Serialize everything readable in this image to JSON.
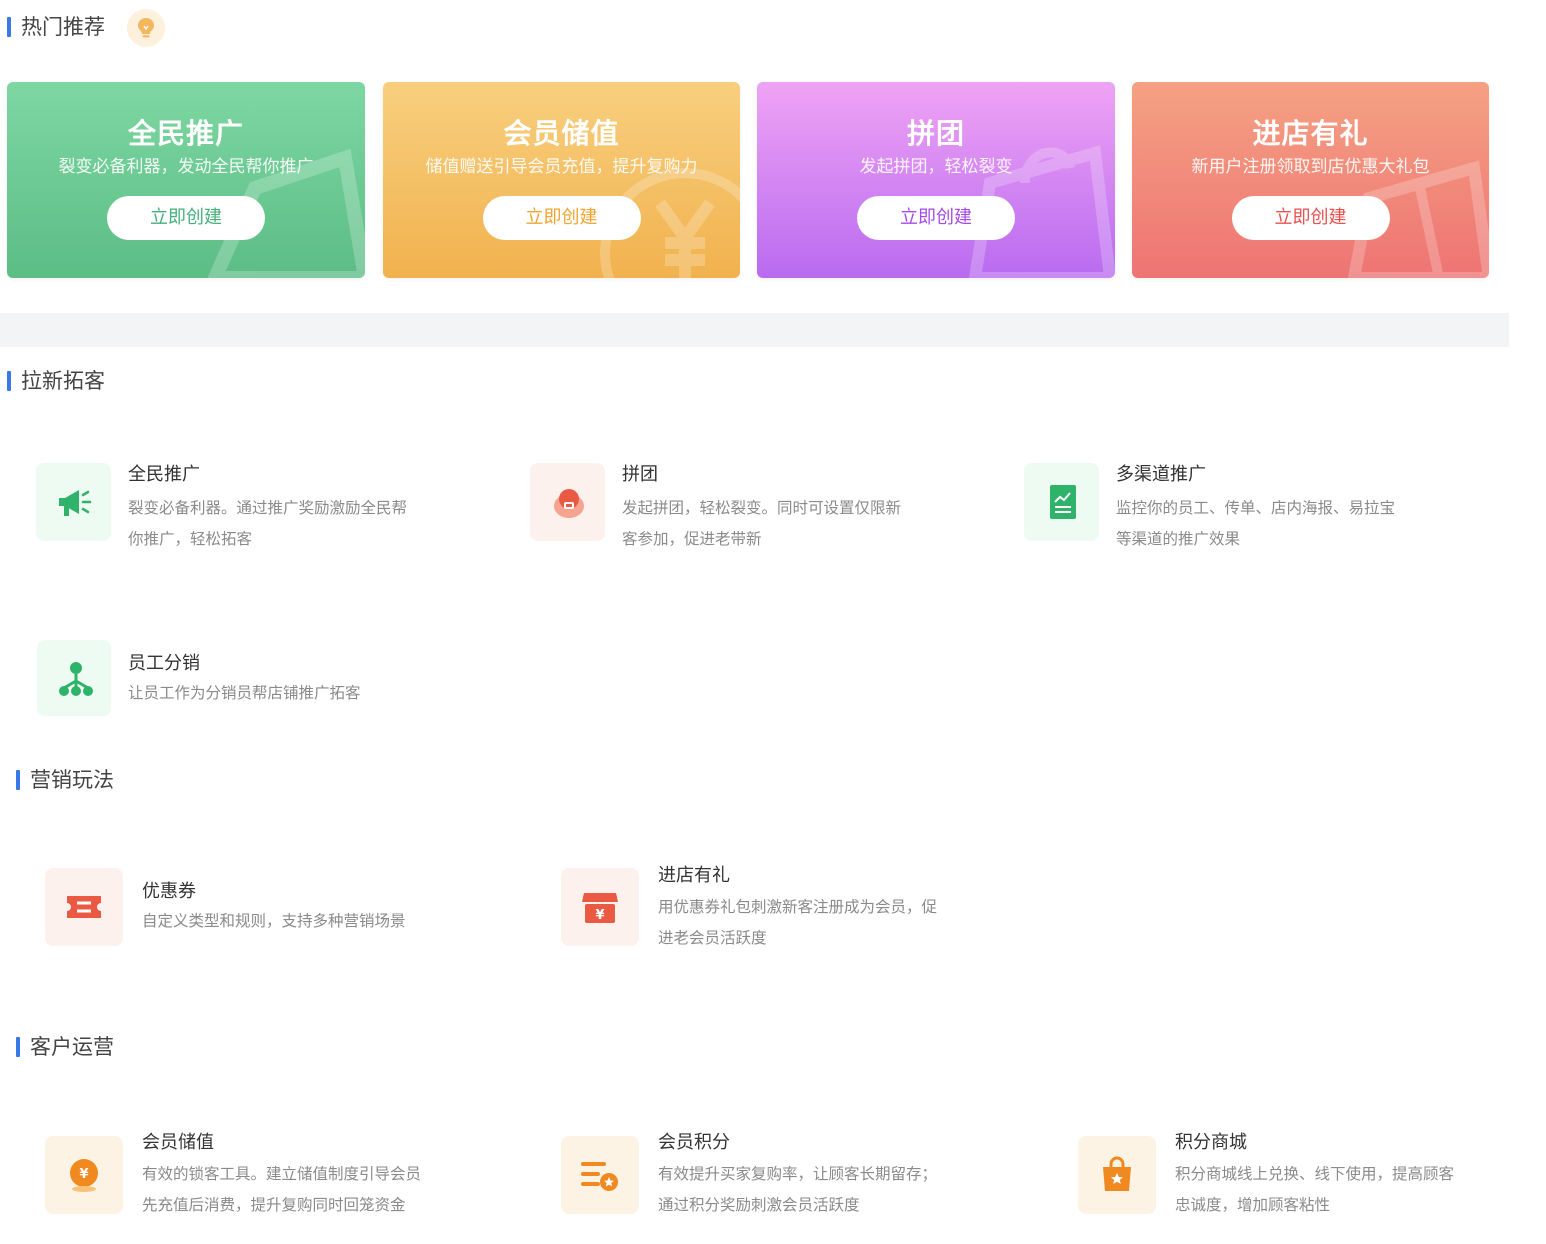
{
  "hot": {
    "title": "热门推荐",
    "cards": [
      {
        "title": "全民推广",
        "desc": "裂变必备利器，发动全民帮你推广",
        "button": "立即创建",
        "color": "#46b07a"
      },
      {
        "title": "会员储值",
        "desc": "储值赠送引导会员充值，提升复购力",
        "button": "立即创建",
        "color": "#f0a630"
      },
      {
        "title": "拼团",
        "desc": "发起拼团，轻松裂变",
        "button": "立即创建",
        "color": "#a64be8"
      },
      {
        "title": "进店有礼",
        "desc": "新用户注册领取到店优惠大礼包",
        "button": "立即创建",
        "color": "#e8514f"
      }
    ]
  },
  "acquisition": {
    "title": "拉新拓客",
    "items": [
      {
        "title": "全民推广",
        "desc1": "裂变必备利器。通过推广奖励激励全民帮",
        "desc2": "你推广，轻松拓客",
        "icon": "megaphone-icon"
      },
      {
        "title": "拼团",
        "desc1": "发起拼团，轻松裂变。同时可设置仅限新",
        "desc2": "客参加，促进老带新",
        "icon": "group-buy-icon"
      },
      {
        "title": "多渠道推广",
        "desc1": "监控你的员工、传单、店内海报、易拉宝",
        "desc2": "等渠道的推广效果",
        "icon": "chart-doc-icon"
      },
      {
        "title": "员工分销",
        "desc1": "让员工作为分销员帮店铺推广拓客",
        "desc2": "",
        "icon": "org-tree-icon"
      }
    ]
  },
  "marketing": {
    "title": "营销玩法",
    "items": [
      {
        "title": "优惠券",
        "desc1": "自定义类型和规则，支持多种营销场景",
        "desc2": "",
        "icon": "ticket-icon"
      },
      {
        "title": "进店有礼",
        "desc1": "用优惠券礼包刺激新客注册成为会员，促",
        "desc2": "进老会员活跃度",
        "icon": "store-gift-icon"
      }
    ]
  },
  "customer": {
    "title": "客户运营",
    "items": [
      {
        "title": "会员储值",
        "desc1": "有效的锁客工具。建立储值制度引导会员",
        "desc2": "先充值后消费，提升复购同时回笼资金",
        "icon": "coin-icon"
      },
      {
        "title": "会员积分",
        "desc1": "有效提升买家复购率，让顾客长期留存；",
        "desc2": "通过积分奖励刺激会员活跃度",
        "icon": "points-list-icon"
      },
      {
        "title": "积分商城",
        "desc1": "积分商城线上兑换、线下使用，提高顾客",
        "desc2": "忠诚度，增加顾客粘性",
        "icon": "shopping-bag-icon"
      }
    ]
  }
}
